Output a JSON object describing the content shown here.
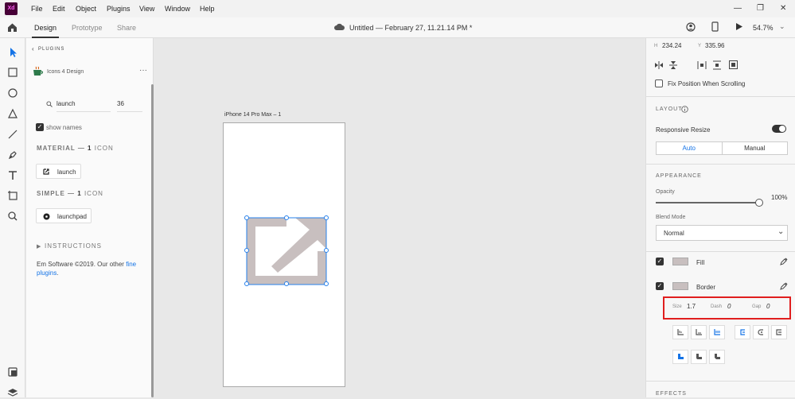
{
  "menubar": {
    "app_logo": "Xd",
    "items": [
      "File",
      "Edit",
      "Object",
      "Plugins",
      "View",
      "Window",
      "Help"
    ]
  },
  "toolbar": {
    "tabs": [
      "Design",
      "Prototype",
      "Share"
    ],
    "document_title": "Untitled — February 27, 11.21.14 PM *",
    "zoom": "54.7%"
  },
  "plugin_panel": {
    "back_label": "PLUGINS",
    "plugin_name": "Icons 4 Design",
    "search_value": "launch",
    "size_value": "36",
    "show_names_label": "show names",
    "material_heading_prefix": "MATERIAL —",
    "material_count": "1",
    "material_suffix": "ICON",
    "material_icon_label": "launch",
    "simple_heading_prefix": "SIMPLE —",
    "simple_count": "1",
    "simple_suffix": "ICON",
    "simple_icon_label": "launchpad",
    "instructions_label": "INSTRUCTIONS",
    "footer_text": "Em Software ©2019. Our other",
    "footer_link": "fine plugins",
    "footer_end": "."
  },
  "canvas": {
    "artboard_label": "iPhone 14 Pro Max – 1",
    "icon_color": "#c8bfbf",
    "selection_color": "#2680eb"
  },
  "properties": {
    "h_label": "H",
    "h_value": "234.24",
    "y_label": "Y",
    "y_value": "335.96",
    "fix_position_label": "Fix Position When Scrolling",
    "layout_title": "LAYOUT",
    "responsive_resize_label": "Responsive Resize",
    "auto_label": "Auto",
    "manual_label": "Manual",
    "appearance_title": "APPEARANCE",
    "opacity_label": "Opacity",
    "opacity_value": "100%",
    "opacity_fraction": 1.0,
    "blend_mode_label": "Blend Mode",
    "blend_mode_value": "Normal",
    "fill_label": "Fill",
    "border_label": "Border",
    "size_label": "Size",
    "size_value": "1.7",
    "dash_label": "Dash",
    "dash_value": "0",
    "gap_label": "Gap",
    "gap_value": "0",
    "effects_title": "EFFECTS",
    "highlight_color": "#e01e1e",
    "accent_color": "#2680eb"
  }
}
